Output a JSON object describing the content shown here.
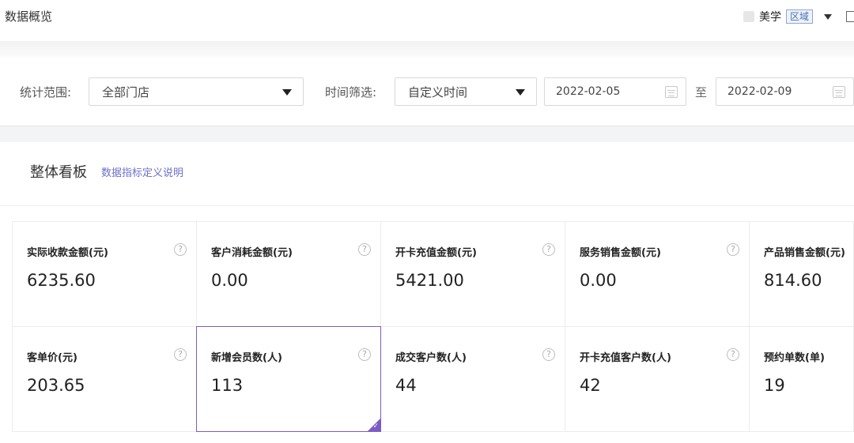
{
  "header": {
    "title": "数据概览",
    "user_name": "美学",
    "region_badge": "区域"
  },
  "filters": {
    "scope_label": "统计范围:",
    "scope_value": "全部门店",
    "time_label": "时间筛选:",
    "time_value": "自定义时间",
    "date_start": "2022-02-05",
    "date_sep": "至",
    "date_end": "2022-02-09"
  },
  "board": {
    "title": "整体看板",
    "link": "数据指标定义说明",
    "help_symbol": "?",
    "cards": [
      {
        "label": "实际收款金额(元)",
        "value": "6235.60"
      },
      {
        "label": "客户消耗金额(元)",
        "value": "0.00"
      },
      {
        "label": "开卡充值金额(元)",
        "value": "5421.00"
      },
      {
        "label": "服务销售金额(元)",
        "value": "0.00"
      },
      {
        "label": "产品销售金额(元)",
        "value": "814.60"
      },
      {
        "label": "客单价(元)",
        "value": "203.65"
      },
      {
        "label": "新增会员数(人)",
        "value": "113"
      },
      {
        "label": "成交客户数(人)",
        "value": "44"
      },
      {
        "label": "开卡充值客户数(人)",
        "value": "42"
      },
      {
        "label": "预约单数(单)",
        "value": "19"
      }
    ]
  },
  "colors": {
    "accent": "#7b5cc4",
    "link": "#6d6fc7",
    "badge": "#4a6fb5"
  }
}
